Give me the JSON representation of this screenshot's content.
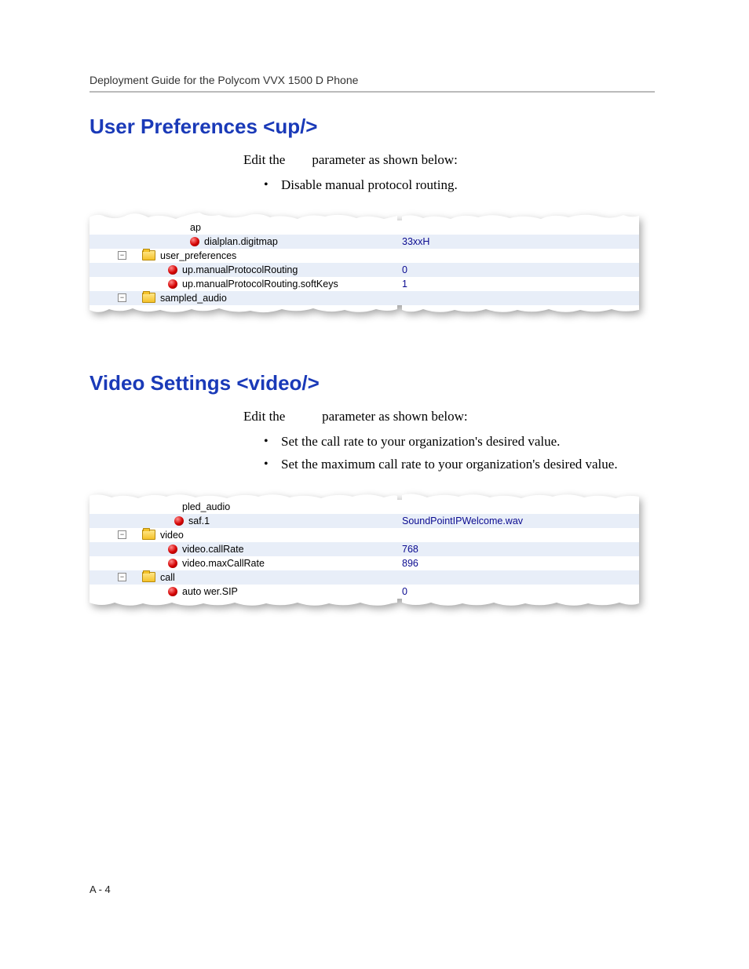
{
  "header": "Deployment Guide for the Polycom VVX 1500 D Phone",
  "page_num": "A - 4",
  "section1": {
    "title": "User Preferences <up/>",
    "intro_1": "Edit the",
    "intro_2": "parameter as shown below:",
    "bullet_0": "Disable manual protocol routing.",
    "tree": {
      "r0_label": "ap",
      "r0_val": "",
      "r1_label": "dialplan.digitmap",
      "r1_val": "33xxH",
      "r2_label": "user_preferences",
      "r2_val": "",
      "r3_label": "up.manualProtocolRouting",
      "r3_val": "0",
      "r4_label": "up.manualProtocolRouting.softKeys",
      "r4_val": "1",
      "r5_label": "sampled_audio",
      "r5_val": ""
    }
  },
  "section2": {
    "title": "Video Settings <video/>",
    "intro_1": "Edit the",
    "intro_2": "parameter as shown below:",
    "bullet_0": "Set the call rate to your organization's desired value.",
    "bullet_1": "Set the maximum call rate to your organization's desired value.",
    "tree": {
      "r0_label": "pled_audio",
      "r0_val": "",
      "r1_label": "saf.1",
      "r1_val": "SoundPointIPWelcome.wav",
      "r2_label": "video",
      "r2_val": "",
      "r3_label": "video.callRate",
      "r3_val": "768",
      "r4_label": "video.maxCallRate",
      "r4_val": "896",
      "r5_label": "call",
      "r5_val": "",
      "r6_label": "auto      wer.SIP",
      "r6_val": "0"
    }
  }
}
